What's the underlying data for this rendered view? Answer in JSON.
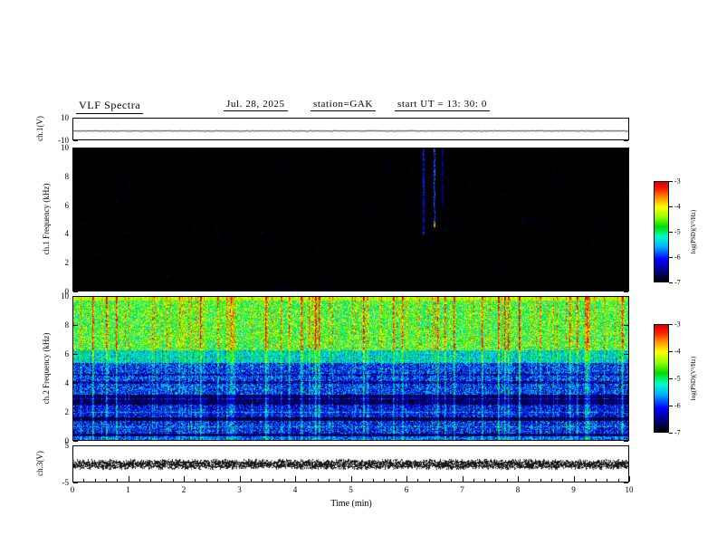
{
  "header": {
    "title": "VLF Spectra",
    "date": "Jul. 28, 2025",
    "station": "station=GAK",
    "start_ut": "start UT =  13: 30: 0"
  },
  "xaxis": {
    "label": "Time (min)",
    "min": 0,
    "max": 10,
    "ticks": [
      "0",
      "1",
      "2",
      "3",
      "4",
      "5",
      "6",
      "7",
      "8",
      "9",
      "10"
    ],
    "minor_step": 0.2
  },
  "colorbar": {
    "label": "log(PSD)(V²/Hz)",
    "ticks": [
      "-3",
      "-4",
      "-5",
      "-6",
      "-7"
    ],
    "min": -7,
    "max": -3,
    "gradient": {
      "positions": [
        0,
        0.1,
        0.22,
        0.35,
        0.45,
        0.55,
        0.65,
        0.75,
        0.85,
        0.93,
        1
      ],
      "colors": [
        "#000000",
        "#000080",
        "#0000ff",
        "#00b4ff",
        "#00ffc8",
        "#00dc00",
        "#96ff00",
        "#ffff00",
        "#ff8c00",
        "#ff1e00",
        "#dc0000"
      ]
    }
  },
  "panels": {
    "ch1v": {
      "ylabel": "ch.1(V)",
      "ymin": -10,
      "ymax": 10,
      "yticks": [
        "10",
        "-10"
      ],
      "ytick_vals": [
        10,
        -10
      ]
    },
    "ch1spec": {
      "ylabel": "ch.1 Frequency (kHz)",
      "ymin": 0,
      "ymax": 10,
      "yticks": [
        "10",
        "8",
        "6",
        "4",
        "2",
        "0"
      ],
      "ytick_vals": [
        10,
        8,
        6,
        4,
        2,
        0
      ]
    },
    "ch2spec": {
      "ylabel": "ch.2 Frequency (kHz)",
      "ymin": 0,
      "ymax": 10,
      "yticks": [
        "10",
        "8",
        "6",
        "4",
        "2",
        "0"
      ],
      "ytick_vals": [
        10,
        8,
        6,
        4,
        2,
        0
      ]
    },
    "ch3v": {
      "ylabel": "ch.3(V)",
      "ymin": -5,
      "ymax": 5,
      "yticks": [
        "5",
        "-5"
      ],
      "ytick_vals": [
        5,
        -5
      ]
    }
  },
  "chart_data": [
    {
      "type": "line",
      "name": "ch1_voltage",
      "ylabel": "ch.1(V)",
      "xlim": [
        0,
        10
      ],
      "ylim": [
        -10,
        10
      ],
      "value": -1.5,
      "description": "nearly flat thin voltage trace across the full 10 min record"
    },
    {
      "type": "heatmap",
      "name": "ch1_spectrogram",
      "ylabel": "ch.1 Frequency (kHz)",
      "xlim": [
        0,
        10
      ],
      "ylim": [
        0,
        10
      ],
      "zlabel": "log(PSD)(V²/Hz)",
      "zlim": [
        -7,
        -3
      ],
      "background_level": -7,
      "speckle_prob": 0.004,
      "streaks": [
        {
          "t": 6.3,
          "f_min": 4.0,
          "f_max": 10.0,
          "level": -6.1
        },
        {
          "t": 6.5,
          "f_min": 4.5,
          "f_max": 10.0,
          "level": -5.9
        },
        {
          "t": 6.65,
          "f_min": 6.0,
          "f_max": 10.0,
          "level": -6.3
        }
      ],
      "spots": [
        {
          "t": 6.5,
          "f": 4.6,
          "level": -3.6
        }
      ],
      "description": "spectrogram at noise floor (black) with a few faint vertical streaks near 6.3-6.7 min"
    },
    {
      "type": "heatmap",
      "name": "ch2_spectrogram",
      "ylabel": "ch.2 Frequency (kHz)",
      "xlim": [
        0,
        10
      ],
      "ylim": [
        0,
        10
      ],
      "zlabel": "log(PSD)(V²/Hz)",
      "zlim": [
        -7,
        -3
      ],
      "bands": [
        {
          "f_min": 9.8,
          "f_max": 10.01,
          "level": -4.4,
          "noise": 0.25
        },
        {
          "f_min": 6.3,
          "f_max": 9.8,
          "level": -4.8,
          "noise": 0.85
        },
        {
          "f_min": 5.4,
          "f_max": 6.3,
          "level": -5.4,
          "noise": 0.6
        },
        {
          "f_min": 3.2,
          "f_max": 5.4,
          "level": -6.1,
          "noise": 0.7
        },
        {
          "f_min": 2.5,
          "f_max": 3.2,
          "level": -6.8,
          "noise": 0.35
        },
        {
          "f_min": 1.6,
          "f_max": 2.5,
          "level": -6.3,
          "noise": 0.6
        },
        {
          "f_min": 1.35,
          "f_max": 1.6,
          "level": -6.9,
          "noise": 0.25
        },
        {
          "f_min": 0.45,
          "f_max": 1.35,
          "level": -6.2,
          "noise": 0.7
        },
        {
          "f_min": 0.05,
          "f_max": 0.3,
          "level": -5.9,
          "noise": 0.6
        },
        {
          "f_min": 0.0,
          "f_max": 10.0,
          "level": -6.8,
          "noise": 0.4
        }
      ],
      "dark_stripes": [
        {
          "f_min": 3.95,
          "f_max": 4.12,
          "drop": 0.45
        },
        {
          "f_min": 4.5,
          "f_max": 4.68,
          "drop": 0.45
        }
      ],
      "bright_lines": [
        {
          "f": 1.95,
          "halfw": 0.05,
          "boost": 0.55
        },
        {
          "f": 0.95,
          "halfw": 0.05,
          "boost": 0.45
        },
        {
          "f": 2.9,
          "halfw": 0.04,
          "boost": 0.5
        }
      ],
      "bursts": {
        "strong_prob": 0.05,
        "strong_min": 1.2,
        "strong_span": 0.8,
        "weak_prob": 0.24,
        "weak_min": 0.3,
        "weak_span": 0.8,
        "upper_gain": 0.95,
        "lower_gain": 0.55
      },
      "description": "broadband hiss -5 to -4 (green/yellow) above 6.3 kHz with frequent red vertical bursts to -3; structured blue bands near 0.5-1.4, 1.6-2.5 and 3.2-5.4 kHz over a -7 floor"
    },
    {
      "type": "line",
      "name": "ch3_voltage",
      "ylabel": "ch.3(V)",
      "xlim": [
        0,
        10
      ],
      "ylim": [
        -5,
        5
      ],
      "value": 0,
      "noise_amplitude": 1.0,
      "description": "dense dark noisy trace centered at 0 V, ~±1 V thick"
    }
  ],
  "seed": 12345
}
